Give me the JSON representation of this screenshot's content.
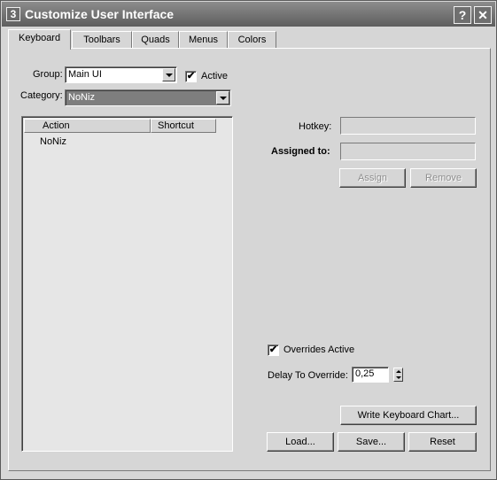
{
  "window": {
    "title": "Customize User Interface",
    "app_icon": "3",
    "help_button": "?",
    "close_button": "✕"
  },
  "tabs": [
    {
      "label": "Keyboard",
      "active": true
    },
    {
      "label": "Toolbars"
    },
    {
      "label": "Quads"
    },
    {
      "label": "Menus"
    },
    {
      "label": "Colors"
    }
  ],
  "keyboard": {
    "group_label": "Group:",
    "group_value": "Main UI",
    "active_label": "Active",
    "active_checked": true,
    "category_label": "Category:",
    "category_value": "NoNiz",
    "list": {
      "columns": [
        "Action",
        "Shortcut"
      ],
      "rows": [
        "NoNiz"
      ]
    },
    "hotkey_label": "Hotkey:",
    "hotkey_value": "",
    "assigned_label": "Assigned to:",
    "assigned_value": "",
    "assign_button": "Assign",
    "remove_button": "Remove",
    "overrides_label": "Overrides Active",
    "overrides_checked": true,
    "delay_label": "Delay To Override:",
    "delay_value": "0,25",
    "write_chart_button": "Write Keyboard Chart...",
    "load_button": "Load...",
    "save_button": "Save...",
    "reset_button": "Reset"
  },
  "icons": {
    "checkmark": "✔",
    "dropdown": "chevron-down-icon",
    "spinner": "spinner-arrows-icon"
  },
  "colors": {
    "titlebar": "#6e6e6e",
    "dialog": "#d6d6d6",
    "selection": "#7e7e7e"
  }
}
